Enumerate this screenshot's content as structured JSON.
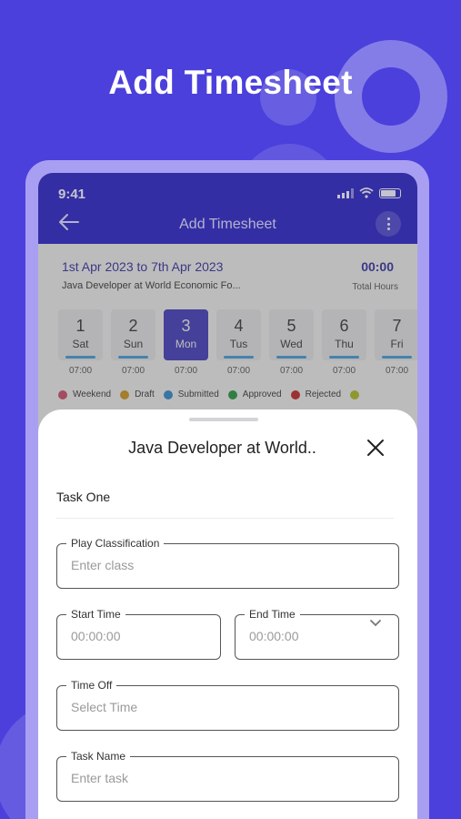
{
  "headline": "Add Timesheet",
  "status": {
    "time": "9:41"
  },
  "appbar": {
    "title": "Add Timesheet"
  },
  "summary": {
    "date_range": "1st Apr 2023 to 7th Apr 2023",
    "job": "Java Developer at World Economic Fo...",
    "total_hours": "00:00",
    "total_hours_label": "Total Hours"
  },
  "days": [
    {
      "num": "1",
      "name": "Sat",
      "hours": "07:00",
      "active": false
    },
    {
      "num": "2",
      "name": "Sun",
      "hours": "07:00",
      "active": false
    },
    {
      "num": "3",
      "name": "Mon",
      "hours": "07:00",
      "active": true
    },
    {
      "num": "4",
      "name": "Tus",
      "hours": "07:00",
      "active": false
    },
    {
      "num": "5",
      "name": "Wed",
      "hours": "07:00",
      "active": false
    },
    {
      "num": "6",
      "name": "Thu",
      "hours": "07:00",
      "active": false
    },
    {
      "num": "7",
      "name": "Fri",
      "hours": "07:00",
      "active": false
    }
  ],
  "legend": [
    {
      "label": "Weekend",
      "color": "#d94b6d"
    },
    {
      "label": "Draft",
      "color": "#d99a1a"
    },
    {
      "label": "Submitted",
      "color": "#2c8fd6"
    },
    {
      "label": "Approved",
      "color": "#1f9b3a"
    },
    {
      "label": "Rejected",
      "color": "#cc1f1f"
    },
    {
      "label": "",
      "color": "#b7c41c"
    }
  ],
  "sheet": {
    "title": "Java Developer at World..",
    "task_label": "Task One",
    "fields": {
      "play_classification": {
        "label": "Play Classification",
        "placeholder": "Enter class"
      },
      "start_time": {
        "label": "Start Time",
        "placeholder": "00:00:00"
      },
      "end_time": {
        "label": "End Time",
        "placeholder": "00:00:00"
      },
      "time_off": {
        "label": "Time Off",
        "placeholder": "Select Time"
      },
      "task_name": {
        "label": "Task Name",
        "placeholder": "Enter task"
      }
    }
  },
  "colors": {
    "background": "#4b40dc",
    "appbar": "#3f37c7",
    "accent": "#2f2aa8"
  }
}
